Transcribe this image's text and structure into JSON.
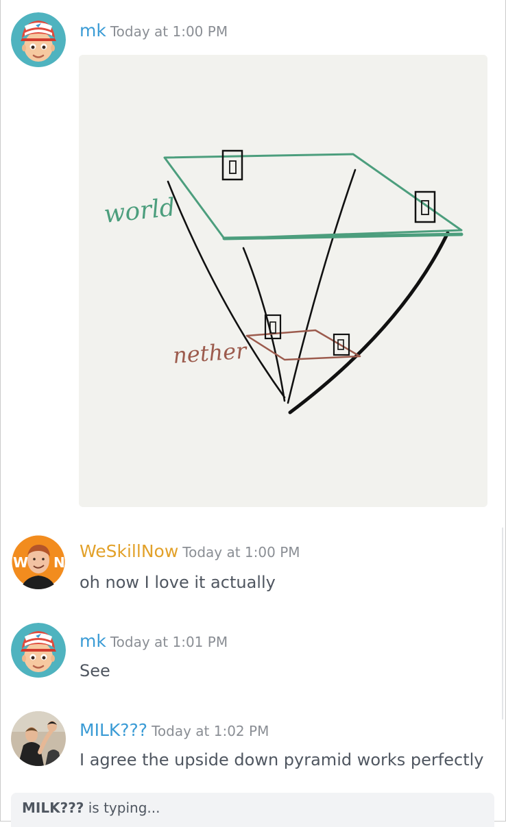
{
  "colors": {
    "mk": "#3a9bd5",
    "weskillnow": "#e2a12a",
    "milk": "#3a9bd5",
    "world_line": "#4c9e7d",
    "nether_line": "#9c5b4d"
  },
  "messages": [
    {
      "username": "mk",
      "timestamp": "Today at 1:00 PM",
      "avatar_icon": "cartoon-boy-cap-icon",
      "attachment": {
        "label_world": "world",
        "label_nether": "nether"
      }
    },
    {
      "username": "WeSkillNow",
      "timestamp": "Today at 1:00 PM",
      "avatar_icon": "photo-avatar",
      "text": "oh now I love it actually"
    },
    {
      "username": "mk",
      "timestamp": "Today at 1:01 PM",
      "avatar_icon": "cartoon-boy-cap-icon",
      "text": "See"
    },
    {
      "username": "MILK???",
      "timestamp": "Today at 1:02 PM",
      "avatar_icon": "photo-avatar",
      "text": "I agree the upside down pyramid works perfectly"
    }
  ],
  "typing": {
    "user": "MILK???",
    "suffix": " is typing..."
  }
}
